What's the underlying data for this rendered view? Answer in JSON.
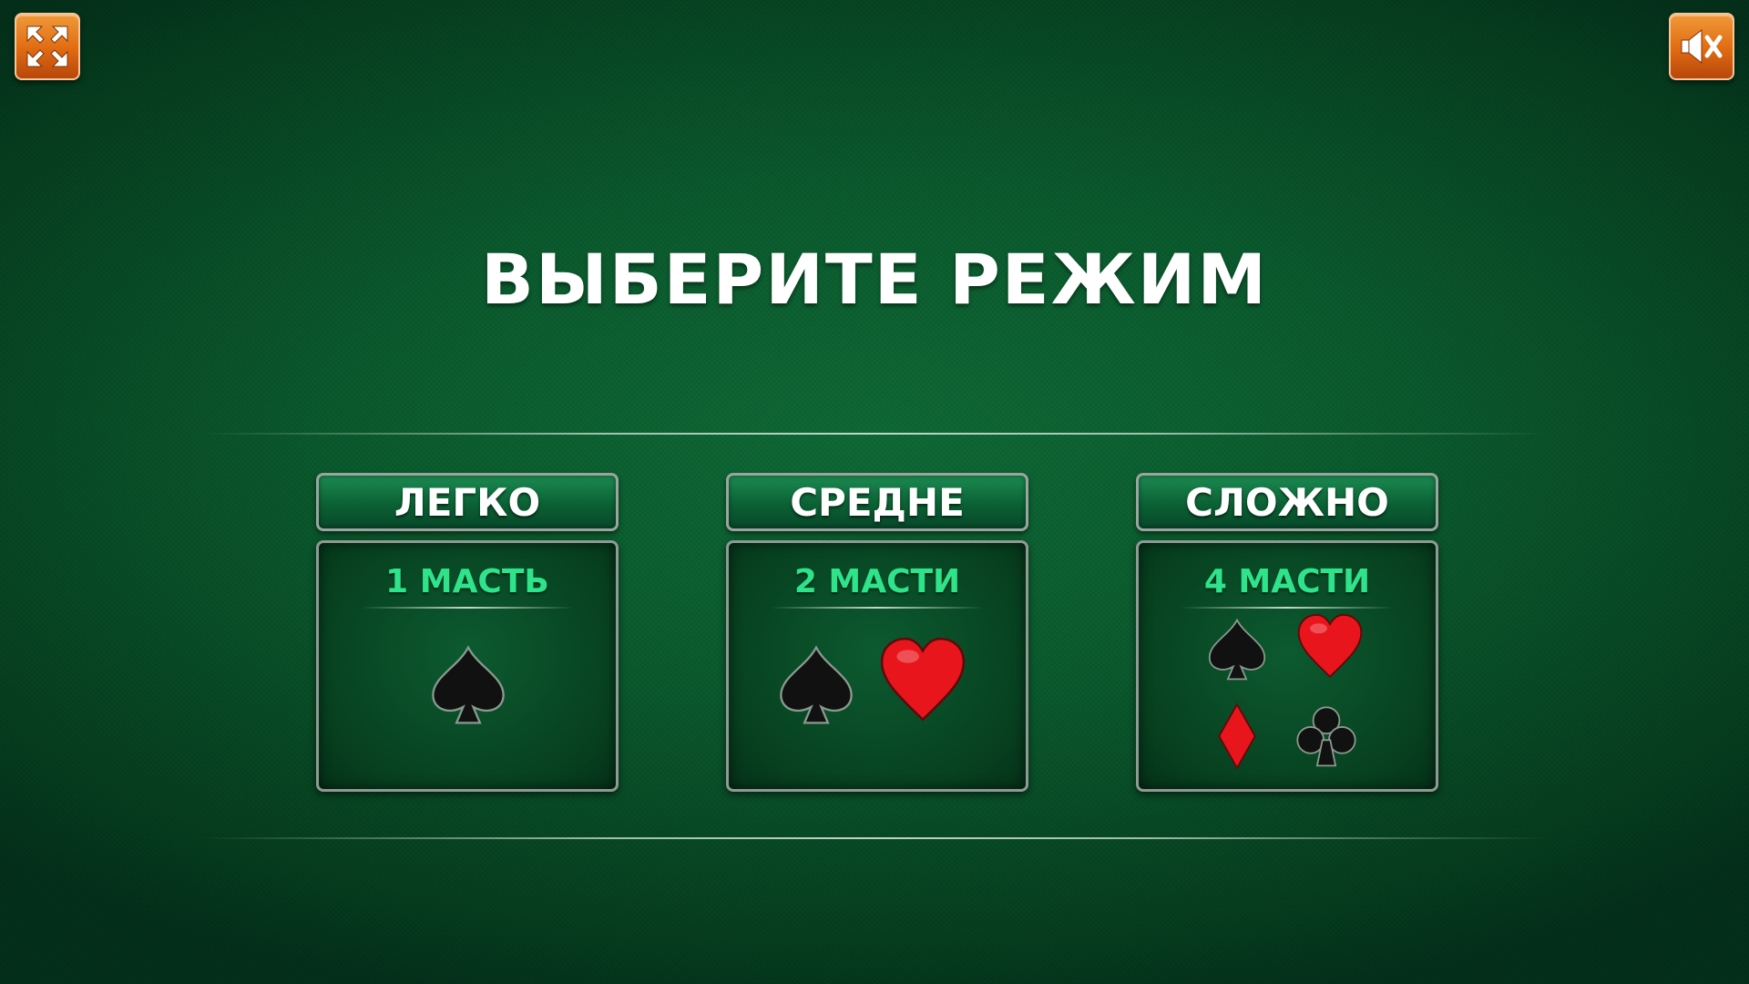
{
  "title": "ВЫБЕРИТЕ РЕЖИМ",
  "controls": {
    "fullscreen_icon": "fullscreen-arrows-icon",
    "sound_icon": "speaker-muted-icon",
    "button_color": "#e47a1c"
  },
  "modes": [
    {
      "label": "ЛЕГКО",
      "suits_label": "1 МАСТЬ",
      "suits": [
        "spade"
      ]
    },
    {
      "label": "СРЕДНЕ",
      "suits_label": "2 МАСТИ",
      "suits": [
        "spade",
        "heart"
      ]
    },
    {
      "label": "СЛОЖНО",
      "suits_label": "4 МАСТИ",
      "suits": [
        "spade",
        "heart",
        "diamond",
        "club"
      ]
    }
  ],
  "colors": {
    "table_green": "#0b5a2e",
    "suits_label": "#2ee38a",
    "title": "#ffffff",
    "red_suit": "#e8161c",
    "black_suit": "#111111"
  }
}
